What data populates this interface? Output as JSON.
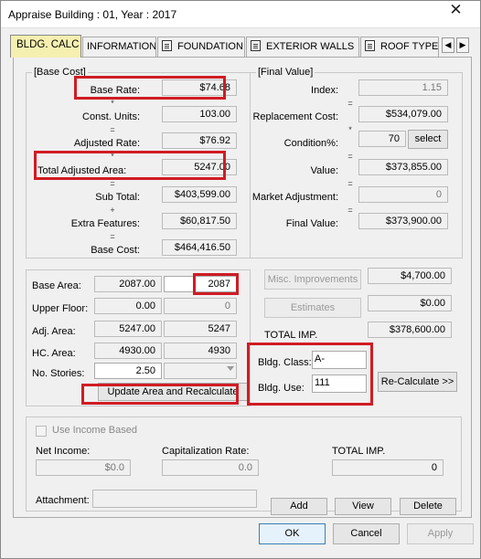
{
  "window": {
    "title": "Appraise Building : 01, Year : 2017",
    "close": "✕"
  },
  "tabs": [
    {
      "label": "BLDG. CALC"
    },
    {
      "label": "INFORMATION"
    },
    {
      "label": "FOUNDATION"
    },
    {
      "label": "EXTERIOR WALLS"
    },
    {
      "label": "ROOF TYPE"
    }
  ],
  "tab_scroll": {
    "left": "◀",
    "right": "▶"
  },
  "base_cost": {
    "title": "[Base Cost]",
    "ops": [
      "*",
      "=",
      "*",
      "=",
      "+",
      "="
    ],
    "rows": [
      {
        "label": "Base Rate:",
        "value": "$74.68"
      },
      {
        "label": "Const. Units:",
        "value": "103.00"
      },
      {
        "label": "Adjusted Rate:",
        "value": "$76.92"
      },
      {
        "label": "Total Adjusted Area:",
        "value": "5247.00"
      },
      {
        "label": "Sub Total:",
        "value": "$403,599.00"
      },
      {
        "label": "Extra Features:",
        "value": "$60,817.50"
      },
      {
        "label": "Base Cost:",
        "value": "$464,416.50"
      }
    ]
  },
  "final_value": {
    "title": "[Final Value]",
    "ops": [
      "=",
      "*",
      "=",
      "=",
      "="
    ],
    "index_label": "Index:",
    "index_value": "1.15",
    "replacement_label": "Replacement Cost:",
    "replacement_value": "$534,079.00",
    "condition_label": "Condition%:",
    "condition_value": "70",
    "select_label": "select",
    "value_label": "Value:",
    "value_value": "$373,855.00",
    "market_label": "Market Adjustment:",
    "market_value": "0",
    "final_label": "Final Value:",
    "final_value": "$373,900.00"
  },
  "area": {
    "base_area_label": "Base Area:",
    "base_area": "2087.00",
    "base_area_edit": "2087",
    "upper_floor_label": "Upper Floor:",
    "upper_floor": "0.00",
    "upper_floor_edit": "0",
    "adj_area_label": "Adj. Area:",
    "adj_area": "5247.00",
    "adj_area_edit": "5247",
    "hc_area_label": "HC. Area:",
    "hc_area": "4930.00",
    "hc_area_edit": "4930",
    "stories_label": "No. Stories:",
    "stories": "2.50",
    "update_button": "Update Area and Recalculate"
  },
  "improvements": {
    "misc_button": "Misc. Improvements",
    "misc_value": "$4,700.00",
    "estimates_button": "Estimates",
    "estimates_value": "$0.00",
    "total_label": "TOTAL IMP.",
    "total_value": "$378,600.00",
    "class_label": "Bldg. Class:",
    "class_value": "A-",
    "use_label": "Bldg. Use:",
    "use_value": "111",
    "recalc_button": "Re-Calculate >>"
  },
  "income": {
    "use_income_label": "Use Income Based",
    "net_income_label": "Net Income:",
    "net_income": "$0.0",
    "cap_rate_label": "Capitalization Rate:",
    "cap_rate": "0.0",
    "total_imp_label": "TOTAL IMP.",
    "total_imp": "0",
    "attachment_label": "Attachment:",
    "add_button": "Add",
    "view_button": "View",
    "delete_button": "Delete"
  },
  "footer": {
    "ok": "OK",
    "cancel": "Cancel",
    "apply": "Apply"
  },
  "colors": {
    "highlight": "#d01c24",
    "active_tab": "#f6f0b0"
  }
}
